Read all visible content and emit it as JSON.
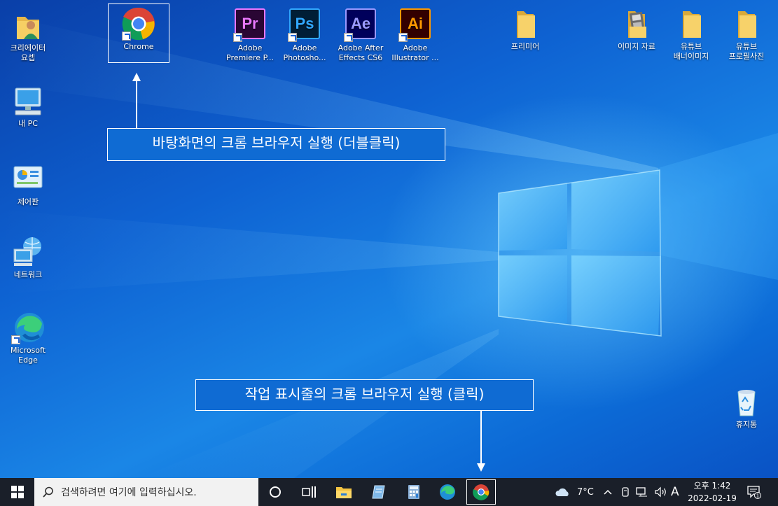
{
  "desktop": {
    "icons": [
      {
        "label": "크리에이터\n요셉"
      },
      {
        "label": "Chrome"
      },
      {
        "label": "Adobe\nPremiere P...",
        "badge": "Pr",
        "color": "#ea77ff",
        "bg": "#2a0634"
      },
      {
        "label": "Adobe\nPhotosho...",
        "badge": "Ps",
        "color": "#31a8ff",
        "bg": "#001e36"
      },
      {
        "label": "Adobe After\nEffects CS6",
        "badge": "Ae",
        "color": "#9999ff",
        "bg": "#00005b"
      },
      {
        "label": "Adobe\nIllustrator ...",
        "badge": "Ai",
        "color": "#ff9a00",
        "bg": "#330000"
      },
      {
        "label": "프리미어"
      },
      {
        "label": "이미지 자료"
      },
      {
        "label": "유튜브\n배너이미지"
      },
      {
        "label": "유튜브\n프로필사진"
      },
      {
        "label": "내 PC"
      },
      {
        "label": "제어판"
      },
      {
        "label": "네트워크"
      },
      {
        "label": "Microsoft\nEdge"
      },
      {
        "label": "휴지통"
      }
    ]
  },
  "callouts": {
    "desktop_chrome": "바탕화면의 크롬 브라우저 실행 (더블클릭)",
    "taskbar_chrome": "작업 표시줄의 크롬 브라우저 실행 (클릭)"
  },
  "taskbar": {
    "search_placeholder": "검색하려면 여기에 입력하십시오.",
    "weather": "7°C",
    "ime": "A",
    "time": "오후 1:42",
    "date": "2022-02-19",
    "notification_count": "1"
  }
}
